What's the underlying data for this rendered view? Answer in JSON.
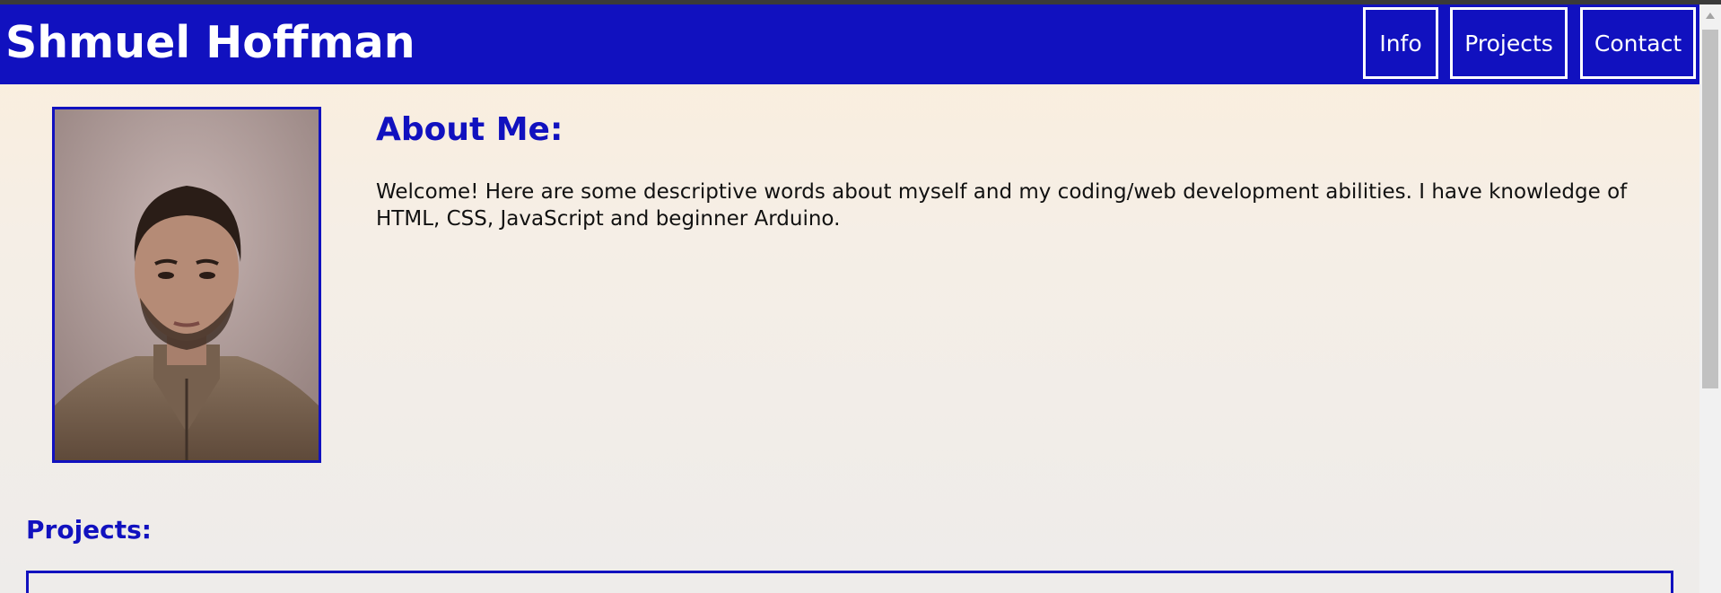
{
  "header": {
    "site_title": "Shmuel Hoffman",
    "nav": [
      {
        "label": "Info"
      },
      {
        "label": "Projects"
      },
      {
        "label": "Contact"
      }
    ]
  },
  "about": {
    "heading": "About Me:",
    "text": "Welcome! Here are some descriptive words about myself and my coding/web development abilities. I have knowledge of HTML, CSS, JavaScript and beginner Arduino."
  },
  "projects": {
    "heading": "Projects:"
  },
  "colors": {
    "brand_blue": "#1111bf",
    "background_top": "#fcefdb",
    "background_bottom": "#eeecea"
  },
  "icons": {
    "scroll_up": "scroll-up-arrow-icon"
  }
}
